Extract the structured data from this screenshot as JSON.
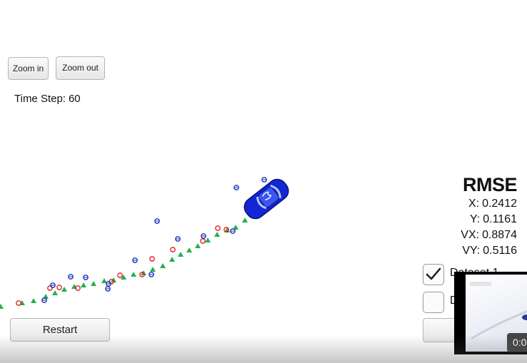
{
  "controls": {
    "zoom_in_label": "Zoom in",
    "zoom_out_label": "Zoom out",
    "restart_label": "Restart"
  },
  "status": {
    "time_step_label": "Time Step:",
    "time_step_value": "60"
  },
  "rmse": {
    "title": "RMSE",
    "rows": [
      {
        "key": "X:",
        "value": "0.2412"
      },
      {
        "key": "Y:",
        "value": "0.1161"
      },
      {
        "key": "VX:",
        "value": "0.8874"
      },
      {
        "key": "VY:",
        "value": "0.5116"
      }
    ]
  },
  "datasets": [
    {
      "label": "Dataset 1",
      "checked": true
    },
    {
      "label": "D",
      "checked": false
    }
  ],
  "video": {
    "time": "0:0"
  },
  "colors": {
    "ground_truth": "#22b14c",
    "lidar": "#1a2ebf",
    "radar": "#e21c1c",
    "car": "#1226d6"
  },
  "icons": {
    "ground_truth_marker": "triangle",
    "lidar_marker": "circle-with-line",
    "radar_marker": "circle",
    "vehicle": "car-icon",
    "checkbox_checked": "check-icon"
  }
}
